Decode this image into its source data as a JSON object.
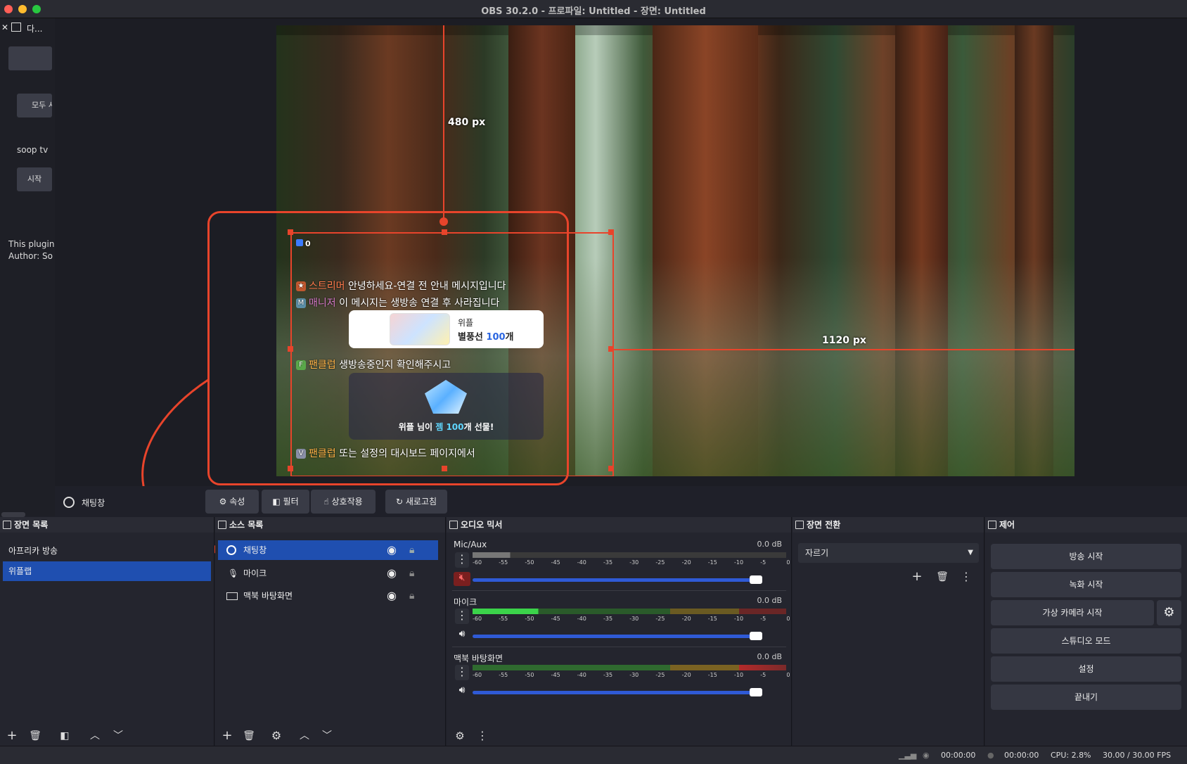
{
  "window": {
    "title": "OBS 30.2.0 - 프로파일: Untitled - 장면: Untitled"
  },
  "left_dock": {
    "tab_label": "다...",
    "button_1": "",
    "button_2": "모두 시",
    "label_1": "soop tv",
    "button_3": "시작",
    "note_1": "This plugin",
    "note_2": "Author: Sor"
  },
  "preview": {
    "height_label": "480 px",
    "width_label": "1120 px",
    "chat": {
      "count": "0",
      "line1_name": "스트리머",
      "line1_text": "안녕하세요-연결 전 안내 메시지입니다",
      "line2_badge": "M",
      "line2_name": "매니저",
      "line2_text": "이 메시지는 생방송 연결 후 사라집니다",
      "card1_name": "위플",
      "card1_prefix": "별풍선 ",
      "card1_value": "100",
      "card1_suffix": "개",
      "line3_badge": "F",
      "line3_name": "팬클럽",
      "line3_text": "생방송중인지 확인해주시고",
      "card2_prefix": "위플 님이 ",
      "card2_value": "젬 100",
      "card2_suffix": "개 선물!",
      "line4_badge": "V",
      "line4_name": "팬클럽",
      "line4_text": "또는 설정의 대시보드 페이지에서"
    }
  },
  "source_toolbar": {
    "source_name": "채팅창",
    "properties": "속성",
    "filters": "필터",
    "interact": "상호작용",
    "refresh": "새로고침"
  },
  "scenes": {
    "title": "장면 목록",
    "items": [
      "아프리카 방송",
      "위플랩"
    ]
  },
  "sources": {
    "title": "소스 목록",
    "items": [
      "채팅창",
      "마이크",
      "맥북 바탕화면"
    ]
  },
  "mixer": {
    "title": "오디오 믹서",
    "ticks": [
      "-60",
      "-55",
      "-50",
      "-45",
      "-40",
      "-35",
      "-30",
      "-25",
      "-20",
      "-15",
      "-10",
      "-5",
      "0"
    ],
    "channels": [
      {
        "name": "Mic/Aux",
        "db": "0.0 dB",
        "muted": true,
        "volume": 1.0
      },
      {
        "name": "마이크",
        "db": "0.0 dB",
        "muted": false,
        "volume": 1.0
      },
      {
        "name": "맥북 바탕화면",
        "db": "0.0 dB",
        "muted": false,
        "volume": 1.0
      }
    ]
  },
  "transitions": {
    "title": "장면 전환",
    "selected": "자르기"
  },
  "controls": {
    "title": "제어",
    "stream": "방송 시작",
    "record": "녹화 시작",
    "virtual_cam": "가상 카메라 시작",
    "studio": "스튜디오 모드",
    "settings": "설정",
    "exit": "끝내기"
  },
  "status": {
    "stream_time": "00:00:00",
    "record_time": "00:00:00",
    "cpu": "CPU: 2.8%",
    "fps": "30.00 / 30.00 FPS"
  },
  "colors": {
    "accent": "#1f4fb0",
    "highlight": "#e8442b",
    "slider": "#2f5ad6"
  }
}
